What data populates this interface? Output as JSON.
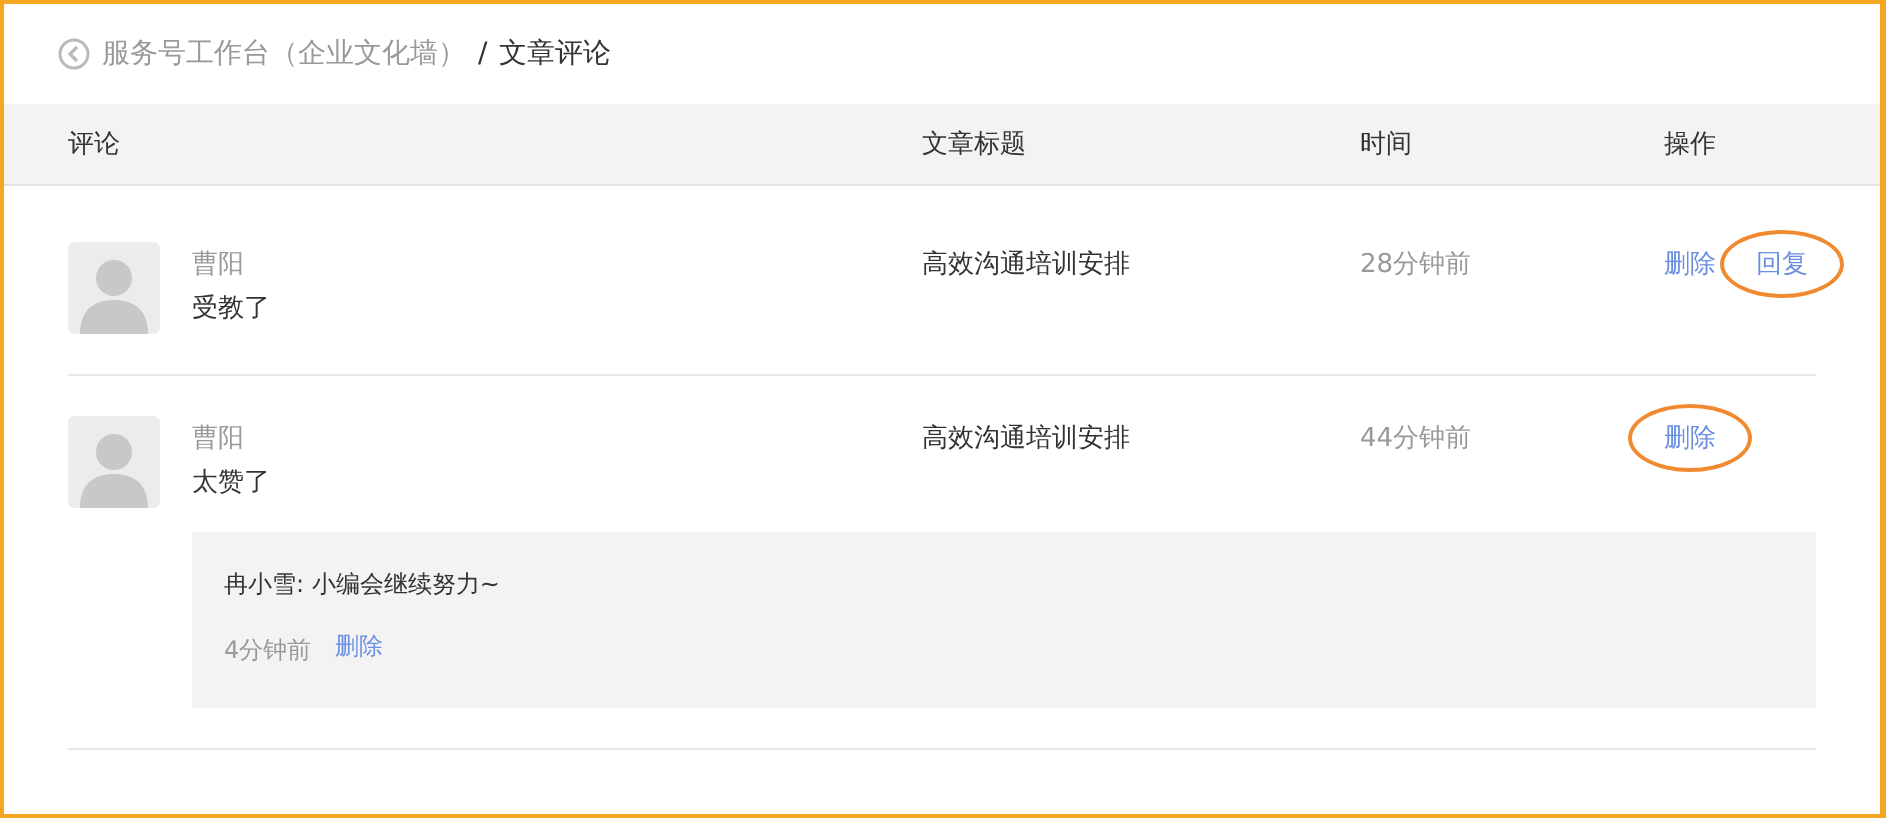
{
  "breadcrumb": {
    "parent": "服务号工作台（企业文化墙）",
    "separator": "/",
    "current": "文章评论"
  },
  "table": {
    "columns": [
      "评论",
      "文章标题",
      "时间",
      "操作"
    ],
    "rows": [
      {
        "author": "曹阳",
        "comment": "受教了",
        "article": "高效沟通培训安排",
        "time": "28分钟前",
        "actions": [
          {
            "label": "删除",
            "highlighted": false
          },
          {
            "label": "回复",
            "highlighted": true
          }
        ]
      },
      {
        "author": "曹阳",
        "comment": "太赞了",
        "article": "高效沟通培训安排",
        "time": "44分钟前",
        "actions": [
          {
            "label": "删除",
            "highlighted": true
          }
        ],
        "reply": {
          "text": "冉小雪: 小编会继续努力~",
          "time": "4分钟前",
          "action": "删除"
        }
      }
    ]
  }
}
